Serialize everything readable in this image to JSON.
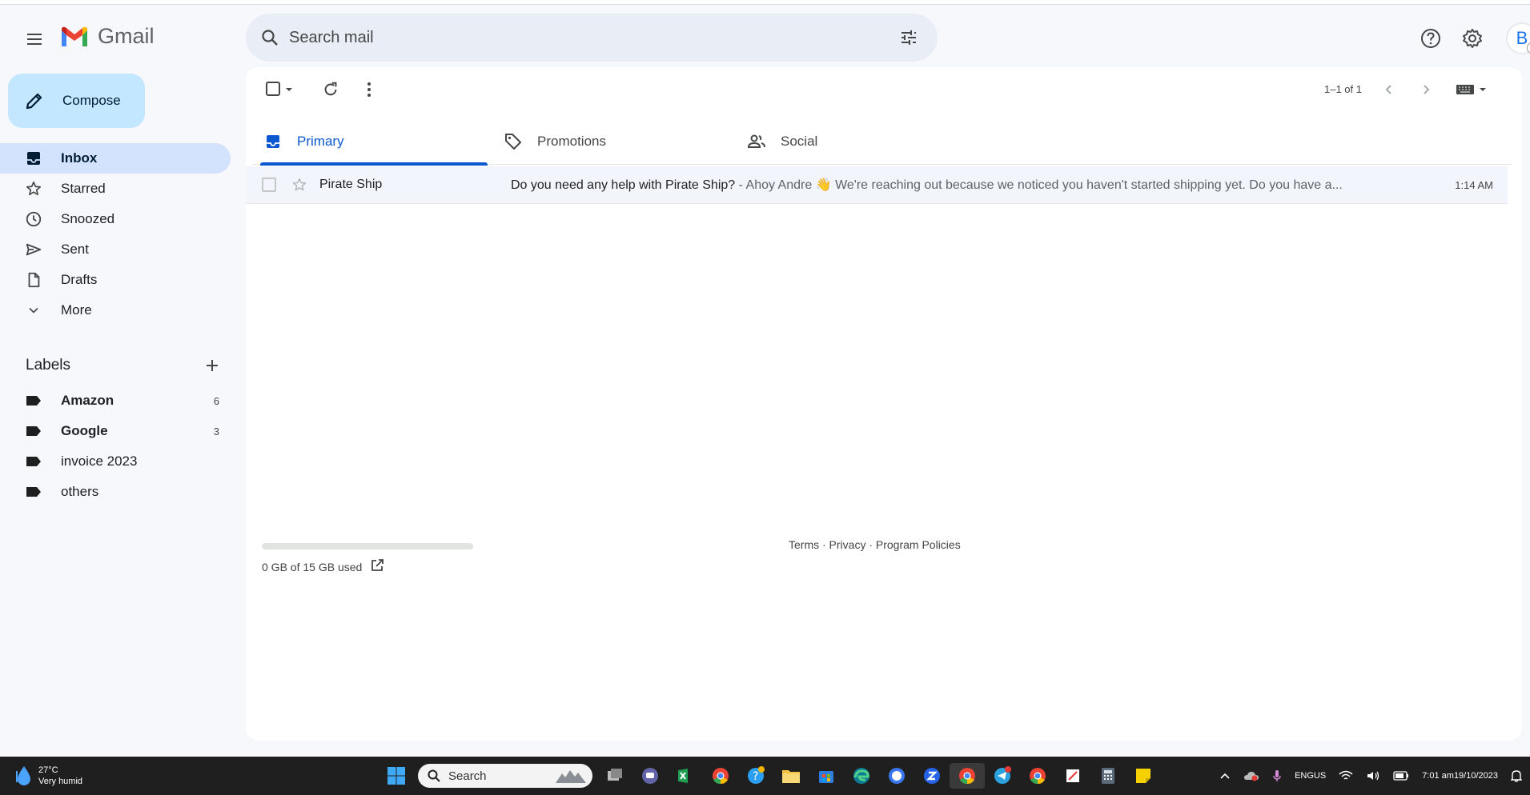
{
  "app": {
    "name": "Gmail"
  },
  "search": {
    "placeholder": "Search mail"
  },
  "compose": {
    "label": "Compose"
  },
  "nav": {
    "items": [
      {
        "label": "Inbox",
        "icon": "inbox-icon",
        "active": true
      },
      {
        "label": "Starred",
        "icon": "star-icon"
      },
      {
        "label": "Snoozed",
        "icon": "clock-icon"
      },
      {
        "label": "Sent",
        "icon": "send-icon"
      },
      {
        "label": "Drafts",
        "icon": "draft-icon"
      },
      {
        "label": "More",
        "icon": "chevron-down-icon"
      }
    ]
  },
  "labels": {
    "title": "Labels",
    "items": [
      {
        "label": "Amazon",
        "count": "6",
        "bold": true
      },
      {
        "label": "Google",
        "count": "3",
        "bold": true
      },
      {
        "label": "invoice 2023",
        "count": "",
        "bold": false
      },
      {
        "label": "others",
        "count": "",
        "bold": false
      }
    ]
  },
  "toolbar": {
    "pager": "1–1 of 1"
  },
  "tabs": [
    {
      "label": "Primary",
      "icon": "inbox-icon",
      "active": true
    },
    {
      "label": "Promotions",
      "icon": "tag-icon"
    },
    {
      "label": "Social",
      "icon": "people-icon"
    }
  ],
  "emails": [
    {
      "sender": "Pirate Ship",
      "subject": "Do you need any help with Pirate Ship?",
      "snippet": " - Ahoy Andre 👋 We're reaching out because we noticed you haven't started shipping yet. Do you have a...",
      "time": "1:14 AM"
    }
  ],
  "footer": {
    "storage": "0 GB of 15 GB used",
    "storage_fraction": 0,
    "links": "Terms · Privacy · Program Policies"
  },
  "avatar": {
    "initial": "B"
  },
  "taskbar": {
    "weather_temp": "27°C",
    "weather_desc": "Very humid",
    "search_label": "Search",
    "lang_top": "ENG",
    "lang_bottom": "US",
    "time": "7:01 am",
    "date": "19/10/2023"
  },
  "colors": {
    "accent": "#0b57d0",
    "compose_bg": "#c2e7ff",
    "active_nav_bg": "#d3e3fd"
  }
}
